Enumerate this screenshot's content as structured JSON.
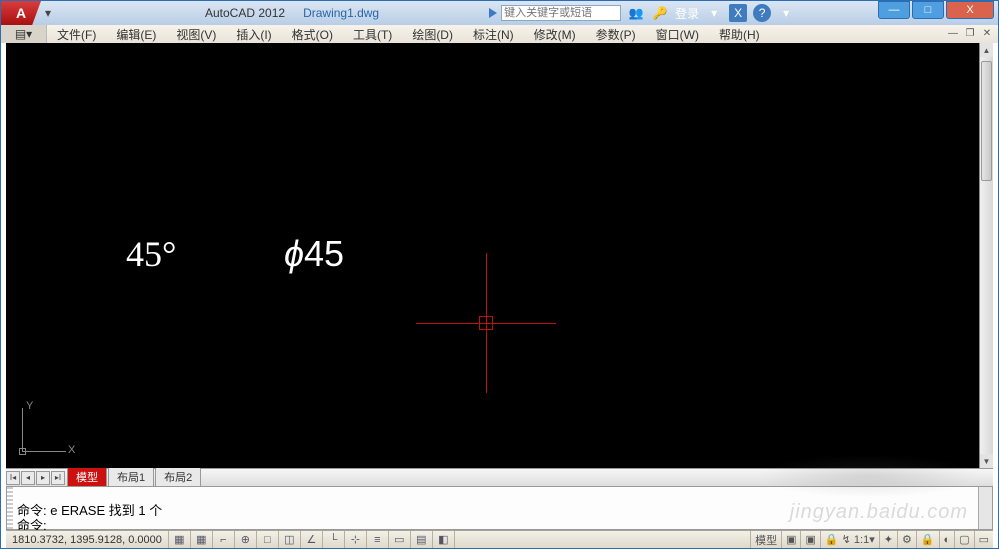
{
  "title": {
    "app": "AutoCAD 2012",
    "doc": "Drawing1.dwg"
  },
  "search": {
    "placeholder": "键入关键字或短语"
  },
  "titleright": {
    "login": "登录"
  },
  "menu": {
    "items": [
      "文件(F)",
      "编辑(E)",
      "视图(V)",
      "插入(I)",
      "格式(O)",
      "工具(T)",
      "绘图(D)",
      "标注(N)",
      "修改(M)",
      "参数(P)",
      "窗口(W)",
      "帮助(H)"
    ]
  },
  "canvas": {
    "text1": "45°",
    "text2_sym": "ϕ",
    "text2_val": "45",
    "ucs_y": "Y",
    "ucs_x": "X"
  },
  "tabs": {
    "active": "模型",
    "t1": "布局1",
    "t2": "布局2"
  },
  "cmd": {
    "line0": " ",
    "line1": "命令: e ERASE 找到 1 个",
    "line2": "命令:"
  },
  "status": {
    "coords": "1810.3732, 1395.9128, 0.0000",
    "model": "模型"
  },
  "watermark": "jingyan.baidu.com"
}
